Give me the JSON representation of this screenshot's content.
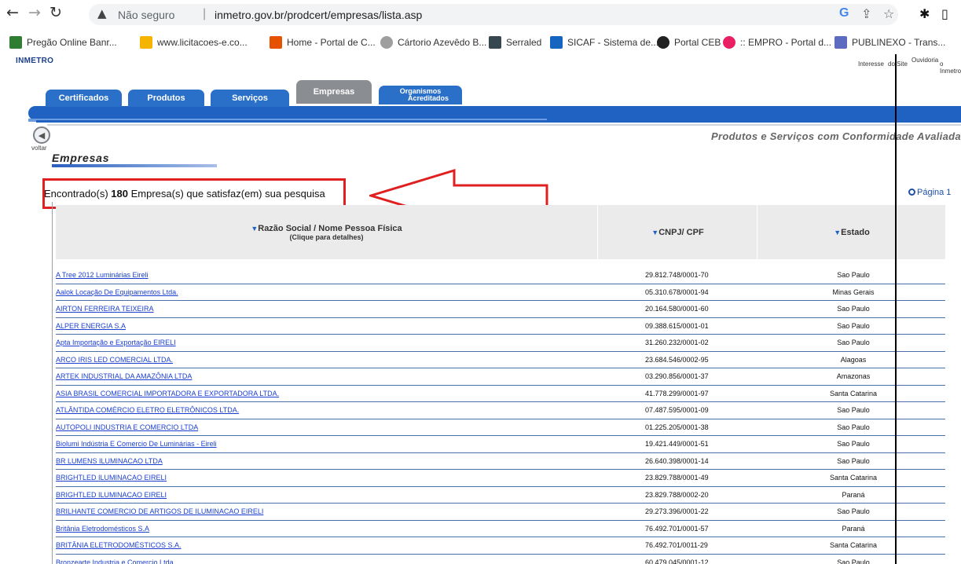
{
  "browser": {
    "security_label": "Não seguro",
    "url": "inmetro.gov.br/prodcert/empresas/lista.asp",
    "bookmarks": [
      {
        "label": "Pregão Online Banr...",
        "color": "#2e7d32"
      },
      {
        "label": "www.licitacoes-e.co...",
        "color": "#f4b400"
      },
      {
        "label": "Home - Portal de C...",
        "color": "#e65100"
      },
      {
        "label": "Cártorio Azevêdo B...",
        "color": "#9e9e9e"
      },
      {
        "label": "Serraled",
        "color": "#37474f"
      },
      {
        "label": "SICAF - Sistema de...",
        "color": "#1565c0"
      },
      {
        "label": "Portal CEB",
        "color": "#212121"
      },
      {
        "label": ":: EMPRO - Portal d...",
        "color": "#e91e63"
      },
      {
        "label": "PUBLINEXO - Trans...",
        "color": "#5c6bc0"
      }
    ]
  },
  "site": {
    "logo": "INMETRO",
    "top_links": [
      "Interesse",
      "do Site",
      "Ouvidoria",
      "o Inmetro"
    ],
    "tabs": [
      "Certificados",
      "Produtos",
      "Serviços",
      "Empresas"
    ],
    "tab_organismos_line1": "Organismos",
    "tab_organismos_line2": "Acreditados",
    "back_label": "voltar",
    "subtitle": "Produtos e Serviços com Conformidade Avaliada",
    "heading": "Empresas"
  },
  "results": {
    "prefix": "Encontrado(s)",
    "count": "180",
    "suffix": "Empresa(s) que satisfaz(em) sua pesquisa",
    "page_label": "Página 1"
  },
  "table": {
    "headers": {
      "name": "Razão Social / Nome Pessoa Física",
      "name_sub": "(Clique para detalhes)",
      "cnpj": "CNPJ/ CPF",
      "state": "Estado"
    },
    "rows": [
      {
        "name": "A Tree 2012 Luminárias Eireli",
        "cnpj": "29.812.748/0001-70",
        "state": "Sao Paulo"
      },
      {
        "name": "Aalok Locação De Equipamentos Ltda.",
        "cnpj": "05.310.678/0001-94",
        "state": "Minas Gerais"
      },
      {
        "name": "AIRTON FERREIRA TEIXEIRA",
        "cnpj": "20.164.580/0001-60",
        "state": "Sao Paulo"
      },
      {
        "name": "ALPER ENERGIA S.A",
        "cnpj": "09.388.615/0001-01",
        "state": "Sao Paulo"
      },
      {
        "name": "Apta Importação e Exportação EIRELI",
        "cnpj": "31.260.232/0001-02",
        "state": "Sao Paulo"
      },
      {
        "name": "ARCO IRIS LED COMERCIAL LTDA.",
        "cnpj": "23.684.546/0002-95",
        "state": "Alagoas"
      },
      {
        "name": "ARTEK INDUSTRIAL DA AMAZÔNIA LTDA",
        "cnpj": "03.290.856/0001-37",
        "state": "Amazonas"
      },
      {
        "name": "ASIA BRASIL COMERCIAL IMPORTADORA E EXPORTADORA LTDA.",
        "cnpj": "41.778.299/0001-97",
        "state": "Santa Catarina"
      },
      {
        "name": "ATLÂNTIDA COMÉRCIO ELETRO ELETRÔNICOS LTDA.",
        "cnpj": "07.487.595/0001-09",
        "state": "Sao Paulo"
      },
      {
        "name": "AUTOPOLI INDUSTRIA E COMERCIO LTDA",
        "cnpj": "01.225.205/0001-38",
        "state": "Sao Paulo"
      },
      {
        "name": "Biolumi Indústria E Comercio De Luminárias - Eireli",
        "cnpj": "19.421.449/0001-51",
        "state": "Sao Paulo"
      },
      {
        "name": "BR LUMENS ILUMINACAO LTDA",
        "cnpj": "26.640.398/0001-14",
        "state": "Sao Paulo"
      },
      {
        "name": "BRIGHTLED ILUMINACAO EIRELI",
        "cnpj": "23.829.788/0001-49",
        "state": "Santa Catarina"
      },
      {
        "name": "BRIGHTLED ILUMINACAO EIRELI",
        "cnpj": "23.829.788/0002-20",
        "state": "Paraná"
      },
      {
        "name": "BRILHANTE COMERCIO DE ARTIGOS DE ILUMINACAO EIRELI",
        "cnpj": "29.273.396/0001-22",
        "state": "Sao Paulo"
      },
      {
        "name": "Britânia Eletrodomésticos S.A",
        "cnpj": "76.492.701/0001-57",
        "state": "Paraná"
      },
      {
        "name": "BRITÂNIA ELETRODOMÉSTICOS S.A.",
        "cnpj": "76.492.701/0011-29",
        "state": "Santa Catarina"
      },
      {
        "name": "Bronzearte Industria e Comercio Ltda.",
        "cnpj": "60.479.045/0001-12",
        "state": "Sao Paulo"
      }
    ]
  },
  "colors": {
    "annotation": "#e02020",
    "link": "#1a3fd0",
    "nav_blue": "#1f62c2"
  }
}
